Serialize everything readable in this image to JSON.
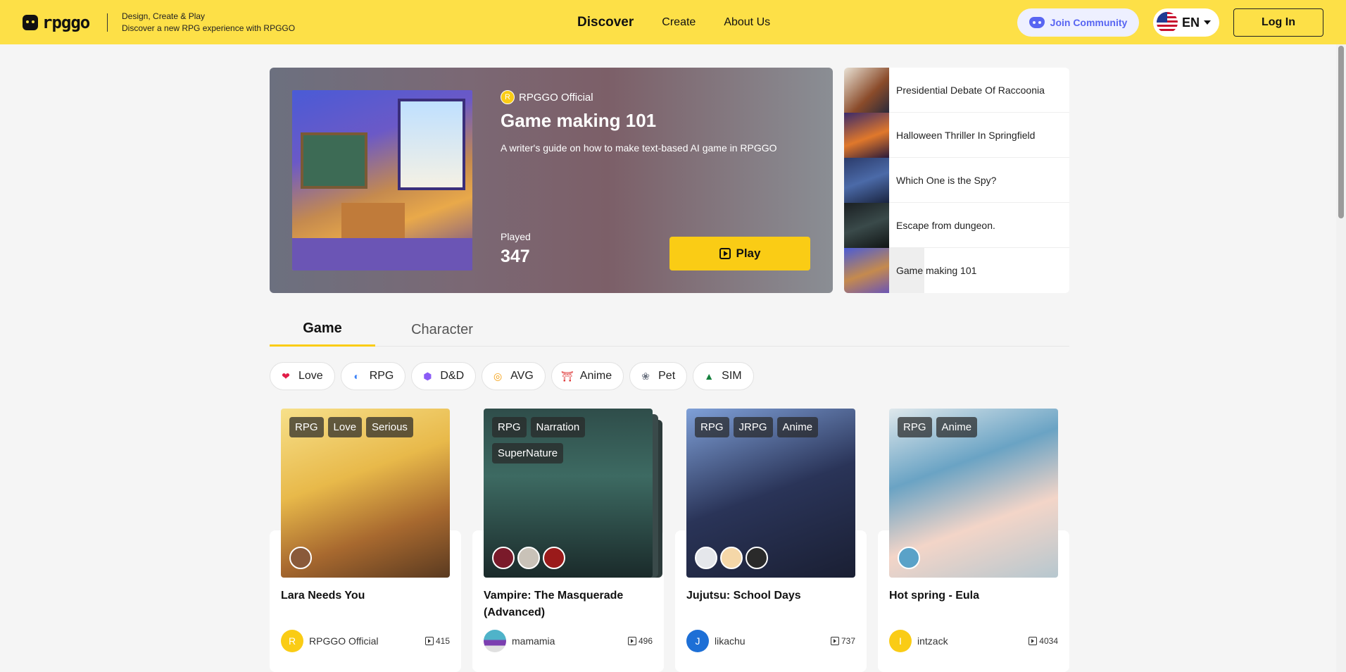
{
  "header": {
    "logo_text": "rpggo",
    "tagline_1": "Design, Create & Play",
    "tagline_2": "Discover a new RPG experience with RPGGO",
    "nav": [
      "Discover",
      "Create",
      "About Us"
    ],
    "join_label": "Join Community",
    "lang": "EN",
    "login_label": "Log In"
  },
  "hero": {
    "author": "RPGGO Official",
    "author_initial": "R",
    "title": "Game making 101",
    "description": "A writer's guide on how to make text-based AI game in RPGGO",
    "played_label": "Played",
    "played": "347",
    "play_label": "Play"
  },
  "side_list": [
    "Presidential Debate Of Raccoonia",
    "Halloween Thriller In Springfield",
    "Which One is the Spy?",
    "Escape from dungeon.",
    "Game making 101"
  ],
  "tabs": [
    "Game",
    "Character"
  ],
  "chips": [
    {
      "label": "Love",
      "icon": "heart-icon"
    },
    {
      "label": "RPG",
      "icon": "masks-icon"
    },
    {
      "label": "D&D",
      "icon": "dice-icon"
    },
    {
      "label": "AVG",
      "icon": "compass-icon"
    },
    {
      "label": "Anime",
      "icon": "torii-icon"
    },
    {
      "label": "Pet",
      "icon": "paw-icon"
    },
    {
      "label": "SIM",
      "icon": "sim-icon"
    }
  ],
  "cards": [
    {
      "title": "Lara Needs You",
      "tags": [
        "RPG",
        "Love",
        "Serious"
      ],
      "author": "RPGGO Official",
      "author_initial": "R",
      "plays": "415"
    },
    {
      "title": "Vampire: The Masquerade (Advanced)",
      "tags": [
        "RPG",
        "Narration",
        "SuperNature"
      ],
      "author": "mamamia",
      "author_initial": "",
      "plays": "496"
    },
    {
      "title": "Jujutsu: School Days",
      "tags": [
        "RPG",
        "JRPG",
        "Anime"
      ],
      "author": "likachu",
      "author_initial": "J",
      "plays": "737"
    },
    {
      "title": "Hot spring - Eula",
      "tags": [
        "RPG",
        "Anime"
      ],
      "author": "intzack",
      "author_initial": "I",
      "plays": "4034"
    }
  ],
  "colors": {
    "accent": "#fde047",
    "button": "#facc15",
    "discord": "#5865f2"
  }
}
